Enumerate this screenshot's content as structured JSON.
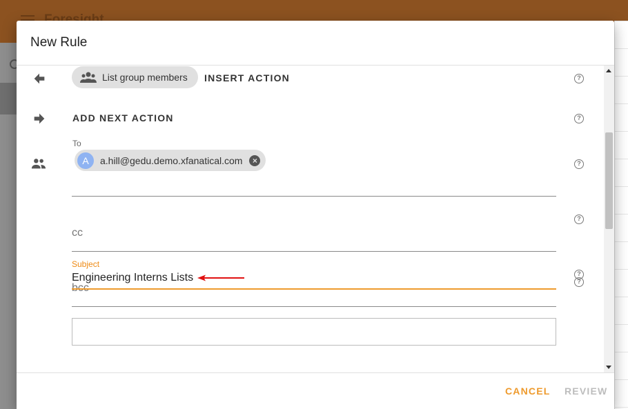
{
  "app": {
    "title": "Foresight"
  },
  "dialog": {
    "title": "New Rule",
    "actions": {
      "chip_label": "List group members",
      "insert_action": "INSERT ACTION",
      "add_next_action": "ADD NEXT ACTION"
    },
    "to": {
      "label": "To",
      "recipient_initial": "A",
      "recipient_email": "a.hill@gedu.demo.xfanatical.com"
    },
    "cc": {
      "placeholder": "cc"
    },
    "bcc": {
      "placeholder": "bcc"
    },
    "subject": {
      "label": "Subject",
      "value": "Engineering Interns Lists"
    },
    "help_glyph": "?",
    "close_glyph": "×",
    "footer": {
      "cancel": "CANCEL",
      "review": "REVIEW"
    }
  },
  "colors": {
    "accent": "#ee9a2c",
    "annotation_arrow": "#e01010",
    "app_bar": "#8c5220"
  }
}
